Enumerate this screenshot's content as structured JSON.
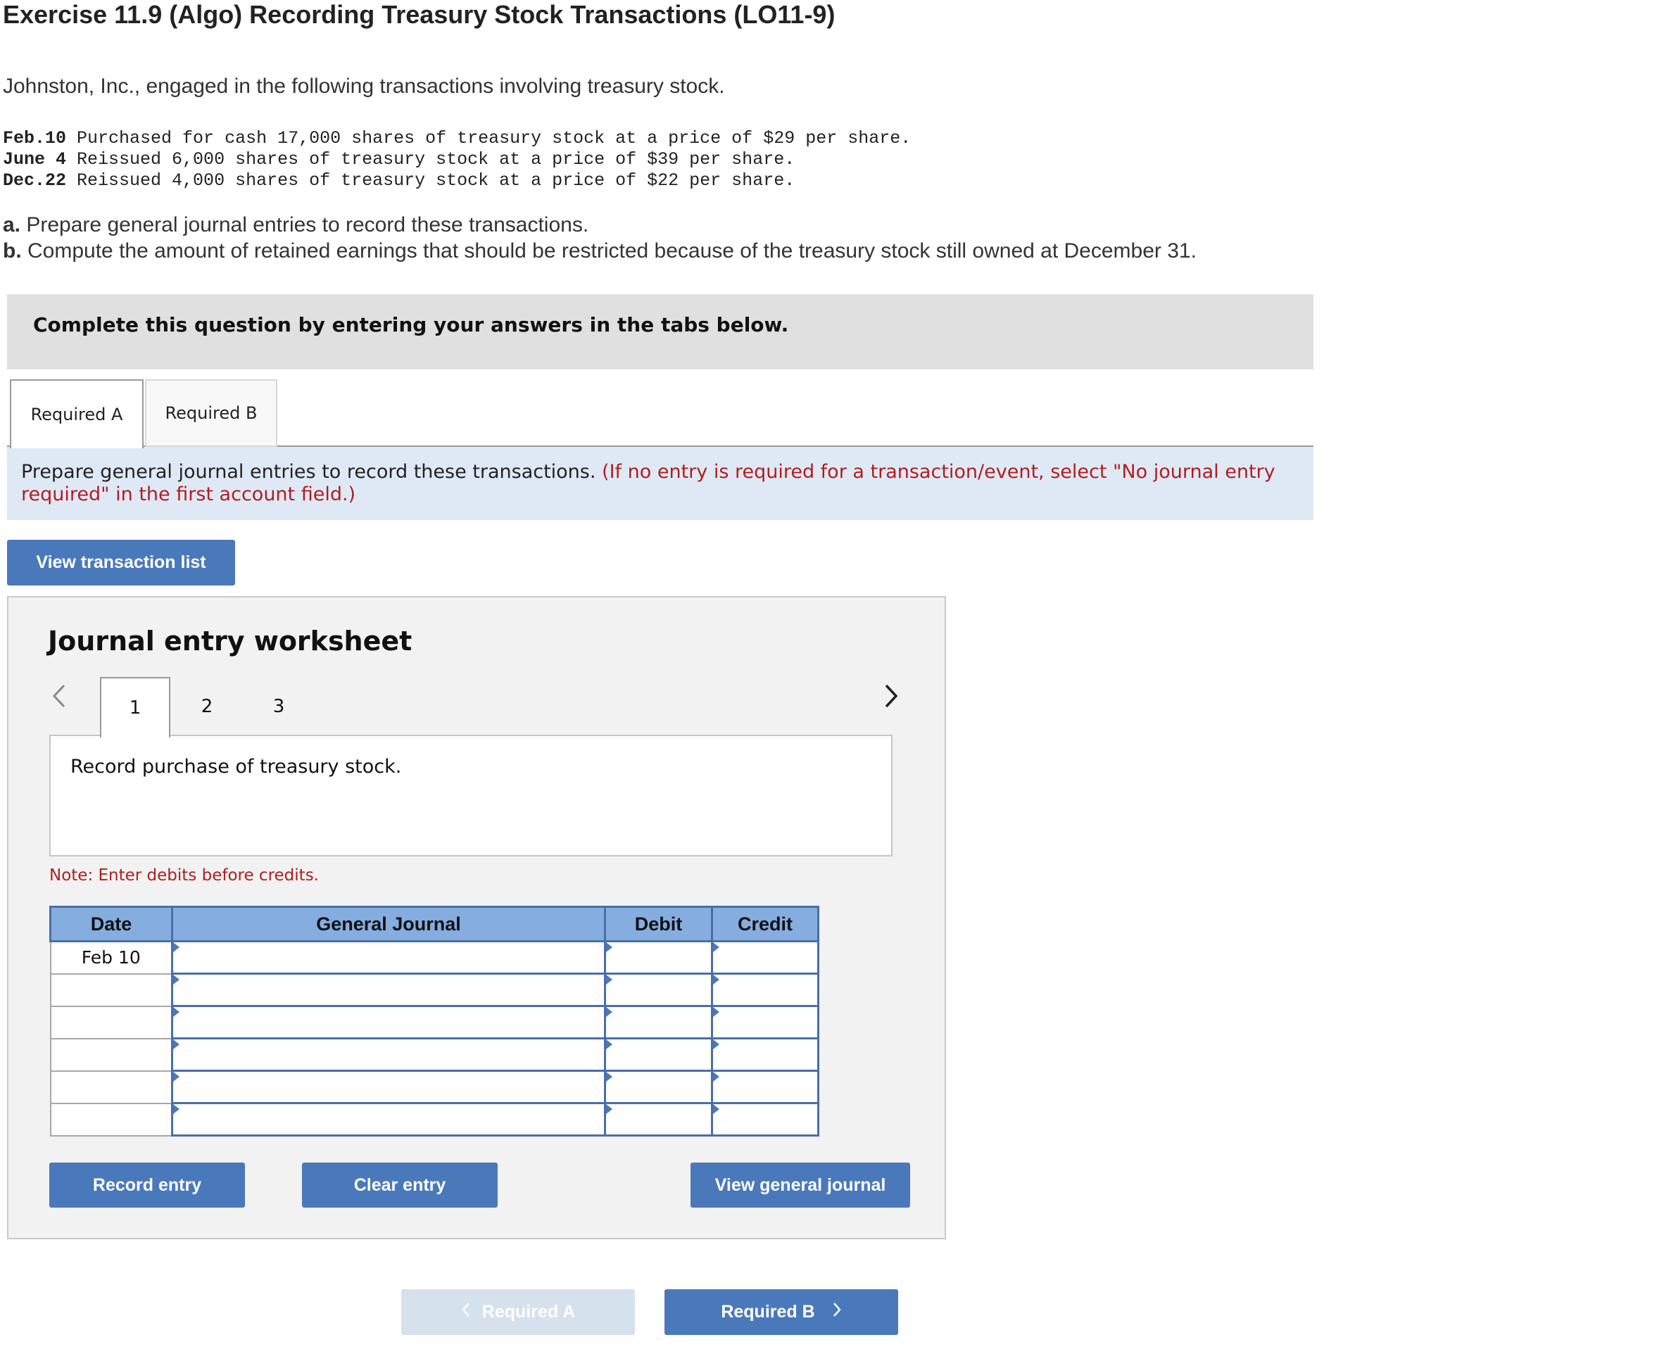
{
  "header": {
    "title": "Exercise 11.9 (Algo) Recording Treasury Stock Transactions (LO11-9)",
    "intro": "Johnston, Inc., engaged in the following transactions involving treasury stock."
  },
  "transactions": [
    {
      "date": "Feb.10",
      "text": "Purchased for cash 17,000 shares of treasury stock at a price of $29 per share."
    },
    {
      "date": "June 4",
      "text": "Reissued 6,000 shares of treasury stock at a price of $39 per share."
    },
    {
      "date": "Dec.22",
      "text": "Reissued 4,000 shares of treasury stock at a price of $22 per share."
    }
  ],
  "requirements": [
    {
      "letter": "a.",
      "text": "Prepare general journal entries to record these transactions."
    },
    {
      "letter": "b.",
      "text": "Compute the amount of retained earnings that should be restricted because of the treasury stock still owned at December 31."
    }
  ],
  "banner": "Complete this question by entering your answers in the tabs below.",
  "tabs": [
    "Required A",
    "Required B"
  ],
  "instructions": {
    "main": "Prepare general journal entries to record these transactions.",
    "hint": "(If no entry is required for a transaction/event, select \"No journal entry required\" in the first account field.)"
  },
  "view_transaction_list": "View transaction list",
  "worksheet": {
    "title": "Journal entry worksheet",
    "prev_icon": "chevron-left",
    "next_icon": "chevron-right",
    "pages": [
      "1",
      "2",
      "3"
    ],
    "description": "Record purchase of treasury stock.",
    "note": "Note: Enter debits before credits.",
    "columns": [
      "Date",
      "General Journal",
      "Debit",
      "Credit"
    ],
    "rows": [
      {
        "date": "Feb 10",
        "account": "",
        "debit": "",
        "credit": ""
      },
      {
        "date": "",
        "account": "",
        "debit": "",
        "credit": ""
      },
      {
        "date": "",
        "account": "",
        "debit": "",
        "credit": ""
      },
      {
        "date": "",
        "account": "",
        "debit": "",
        "credit": ""
      },
      {
        "date": "",
        "account": "",
        "debit": "",
        "credit": ""
      },
      {
        "date": "",
        "account": "",
        "debit": "",
        "credit": ""
      }
    ],
    "buttons": {
      "record": "Record entry",
      "clear": "Clear entry",
      "view_journal": "View general journal"
    }
  },
  "footer_nav": {
    "prev": "Required A",
    "next": "Required B"
  },
  "colors": {
    "primary_button": "#4a79bb",
    "header_cell": "#85ade0",
    "instruction_bg": "#dfe9f5",
    "hint_red": "#b01e1e"
  }
}
